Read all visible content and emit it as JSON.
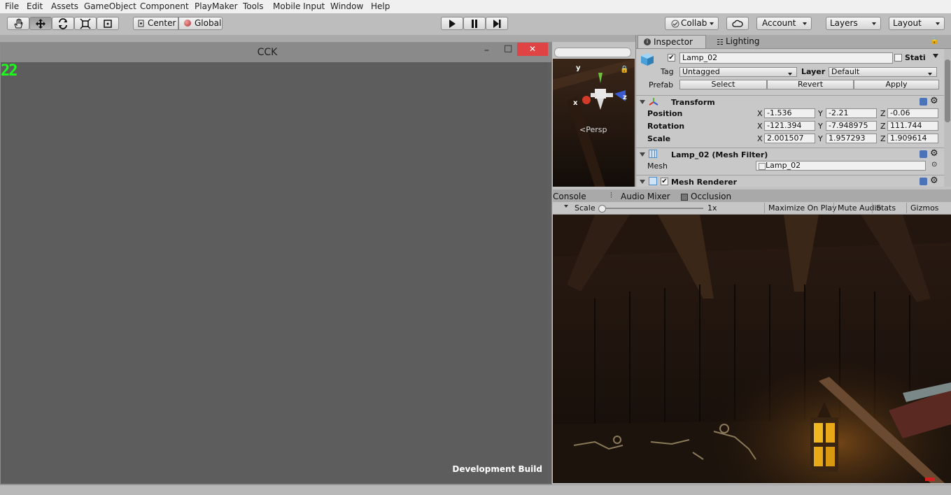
{
  "menu": [
    "File",
    "Edit",
    "Assets",
    "GameObject",
    "Component",
    "PlayMaker",
    "Tools",
    "Mobile Input",
    "Window",
    "Help"
  ],
  "toolbar": {
    "pivot_label": "Center",
    "space_label": "Global",
    "collab_label": "Collab",
    "account_label": "Account",
    "layers_label": "Layers",
    "layout_label": "Layout"
  },
  "game_window": {
    "title": "CCK",
    "fps": "22",
    "dev_build": "Development Build",
    "minimize": "–",
    "maximize": "□",
    "close": "✕"
  },
  "scene": {
    "persp_label": "Persp",
    "axis_y": "y",
    "axis_x": "x",
    "axis_z": "z"
  },
  "inspector": {
    "tab_inspector": "Inspector",
    "tab_lighting": "Lighting",
    "object_name": "Lamp_02",
    "static_label": "Stati",
    "tag_label": "Tag",
    "tag_value": "Untagged",
    "layer_label": "Layer",
    "layer_value": "Default",
    "prefab_label": "Prefab",
    "prefab_select": "Select",
    "prefab_revert": "Revert",
    "prefab_apply": "Apply",
    "transform_title": "Transform",
    "position_label": "Position",
    "rotation_label": "Rotation",
    "scale_label": "Scale",
    "axis_x": "X",
    "axis_y": "Y",
    "axis_z": "Z",
    "position": {
      "x": "-1.536",
      "y": "-2.21",
      "z": "-0.06"
    },
    "rotation": {
      "x": "-121.394",
      "y": "-7.948975",
      "z": "111.744"
    },
    "scale": {
      "x": "2.001507",
      "y": "1.957293",
      "z": "1.909614"
    },
    "mesh_filter_title": "Lamp_02 (Mesh Filter)",
    "mesh_label": "Mesh",
    "mesh_value": "Lamp_02",
    "mesh_renderer_title": "Mesh Renderer"
  },
  "game_panel": {
    "tab_console": "Console",
    "tab_audio_mixer": "Audio Mixer",
    "tab_occlusion": "Occlusion",
    "scale_label": "Scale",
    "scale_value": "1x",
    "maximize_on_play": "Maximize On Play",
    "mute_audio": "Mute Audio",
    "stats": "Stats",
    "gizmos": "Gizmos"
  },
  "colors": {
    "fps_text": "#1aff1a",
    "close_button": "#e04343",
    "lantern_glow": "#e8b020"
  }
}
